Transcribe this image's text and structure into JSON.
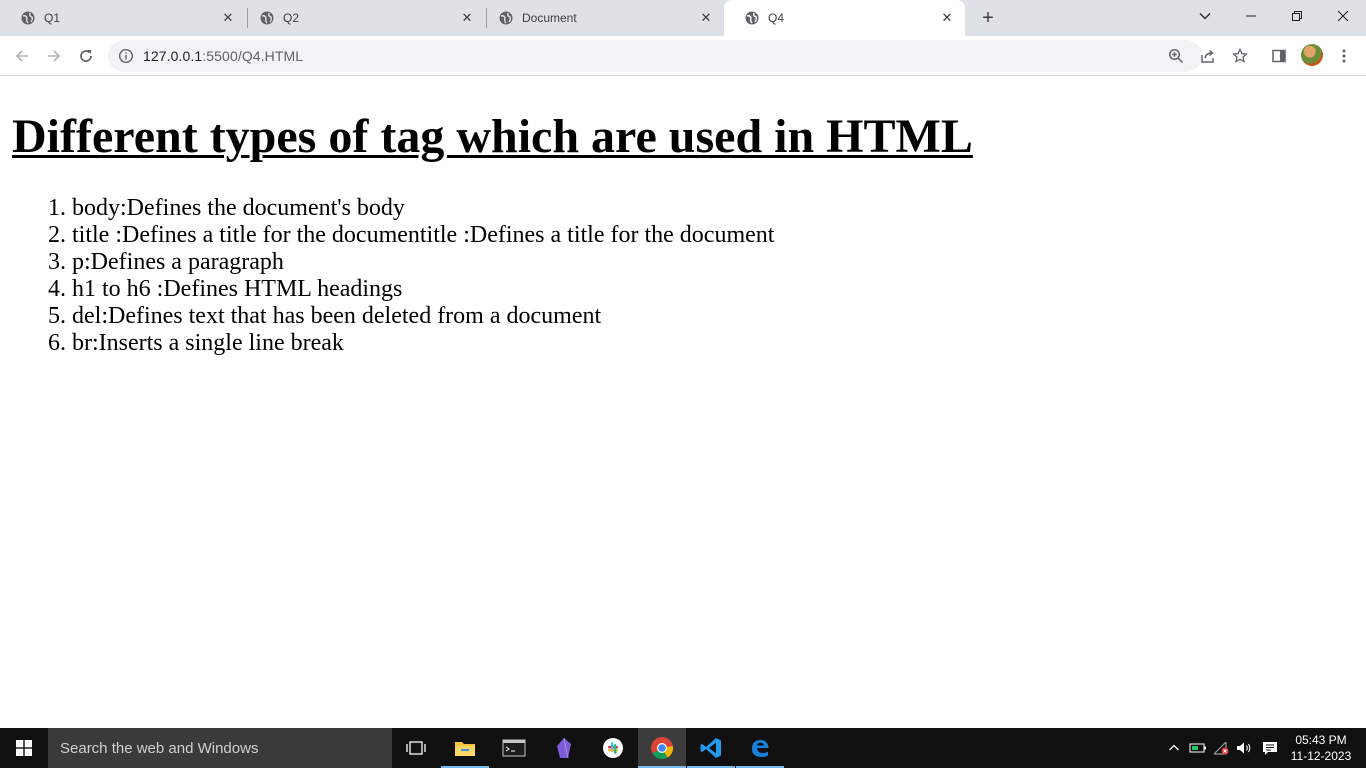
{
  "browser": {
    "tabs": [
      {
        "title": "Q1",
        "close": "✕"
      },
      {
        "title": "Q2",
        "close": "✕"
      },
      {
        "title": "Document",
        "close": "✕"
      },
      {
        "title": "Q4",
        "close": "✕"
      }
    ],
    "new_tab": "+",
    "url_host": "127.0.0.1",
    "url_rest": ":5500/Q4.HTML"
  },
  "page": {
    "heading": "Different types of tag which are used in HTML",
    "items": [
      {
        "num": "1.",
        "text": "body:Defines the document's body"
      },
      {
        "num": "2.",
        "text": "title :Defines a title for the documentitle :Defines a title for the document"
      },
      {
        "num": "3.",
        "text": "p:Defines a paragraph"
      },
      {
        "num": "4.",
        "text": "h1 to h6 :Defines HTML headings"
      },
      {
        "num": "5.",
        "text": "del:Defines text that has been deleted from a document"
      },
      {
        "num": "6.",
        "text": "br:Inserts a single line break"
      }
    ]
  },
  "taskbar": {
    "search_placeholder": "Search the web and Windows",
    "time": "05:43 PM",
    "date": "11-12-2023"
  },
  "colors": {
    "tabstrip": "#dee1e6",
    "omnibox": "#f1f3f4",
    "taskbar": "#101010",
    "taskbar_search": "#3a3a3a",
    "active_app_underline": "#76b9ed"
  }
}
